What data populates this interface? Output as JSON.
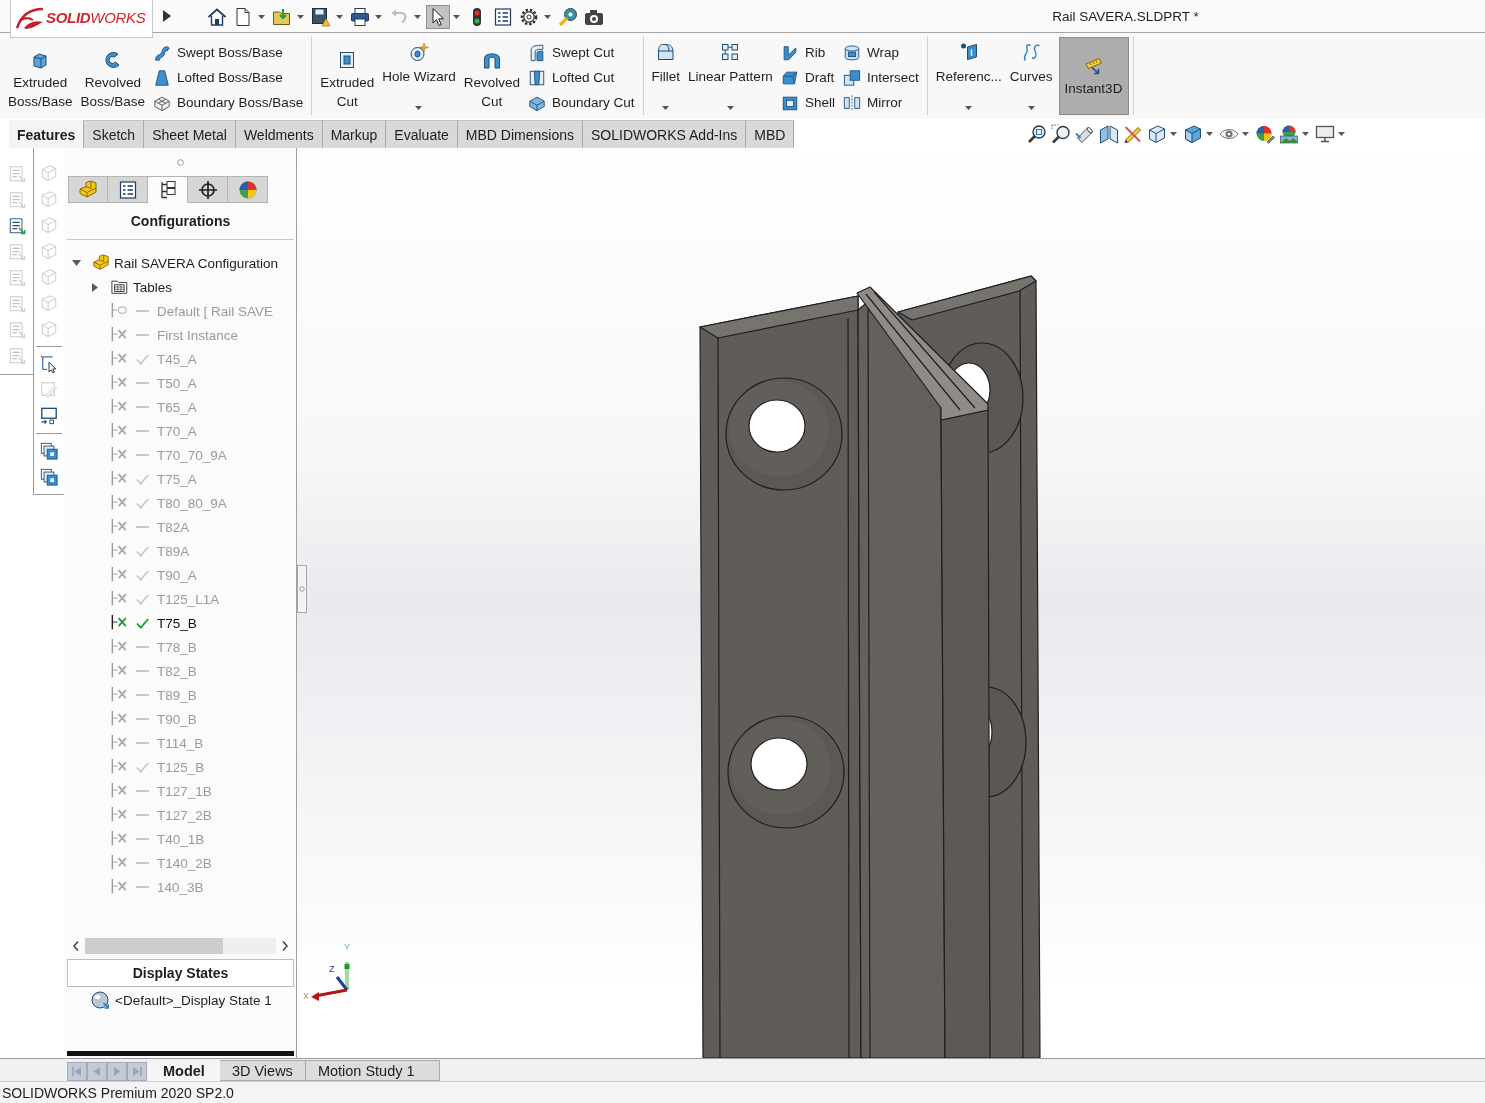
{
  "window": {
    "logo": "**SOLID**WORKS",
    "title": "Rail SAVERA.SLDPRT *"
  },
  "quick_access": [
    {
      "dropdown": false,
      "disabled": false,
      "pressed": false
    },
    {
      "dropdown": true,
      "disabled": false,
      "pressed": false
    },
    {
      "dropdown": true,
      "disabled": false,
      "pressed": false
    },
    {
      "dropdown": true,
      "disabled": false,
      "pressed": false
    },
    {
      "dropdown": true,
      "disabled": false,
      "pressed": false
    },
    {
      "dropdown": true,
      "disabled": true,
      "pressed": false
    },
    {
      "dropdown": true,
      "disabled": false,
      "pressed": true
    },
    {
      "dropdown": false,
      "disabled": false,
      "pressed": false
    },
    {
      "dropdown": false,
      "disabled": false,
      "pressed": false
    },
    {
      "dropdown": true,
      "disabled": false,
      "pressed": false
    },
    {
      "dropdown": false,
      "disabled": false,
      "pressed": false
    },
    {
      "dropdown": false,
      "disabled": false,
      "pressed": false
    }
  ],
  "ribbon": {
    "groups": [
      {
        "items": [
          {
            "kind": "large",
            "label": "Extruded Boss/Base"
          },
          {
            "kind": "large",
            "label": "Revolved Boss/Base"
          },
          {
            "kind": "column",
            "buttons": [
              "Swept Boss/Base",
              "Lofted Boss/Base",
              "Boundary Boss/Base"
            ]
          }
        ]
      },
      {
        "items": [
          {
            "kind": "large",
            "label": "Extruded Cut"
          },
          {
            "kind": "dropdown",
            "label": "Hole Wizard"
          },
          {
            "kind": "large",
            "label": "Revolved Cut"
          },
          {
            "kind": "column",
            "buttons": [
              "Swept Cut",
              "Lofted Cut",
              "Boundary Cut"
            ]
          }
        ]
      },
      {
        "items": [
          {
            "kind": "dropdown",
            "label": "Fillet"
          },
          {
            "kind": "dropdown",
            "label": "Linear Pattern"
          },
          {
            "kind": "column",
            "buttons": [
              "Rib",
              "Draft",
              "Shell"
            ]
          },
          {
            "kind": "column",
            "buttons": [
              "Wrap",
              "Intersect",
              "Mirror"
            ]
          }
        ]
      },
      {
        "items": [
          {
            "kind": "dropdown",
            "label": "Referenc..."
          },
          {
            "kind": "dropdown",
            "label": "Curves"
          },
          {
            "kind": "toggle",
            "label": "Instant3D",
            "on": true
          }
        ]
      }
    ]
  },
  "command_tabs": [
    {
      "label": "Features",
      "selected": true
    },
    {
      "label": "Sketch",
      "selected": false
    },
    {
      "label": "Sheet Metal",
      "selected": false
    },
    {
      "label": "Weldments",
      "selected": false
    },
    {
      "label": "Markup",
      "selected": false
    },
    {
      "label": "Evaluate",
      "selected": false
    },
    {
      "label": "MBD Dimensions",
      "selected": false
    },
    {
      "label": "SOLIDWORKS Add-Ins",
      "selected": false
    },
    {
      "label": "MBD",
      "selected": false
    }
  ],
  "view_toolbar": [
    {
      "dropdown": false
    },
    {
      "dropdown": false
    },
    {
      "dropdown": false
    },
    {
      "dropdown": false
    },
    {
      "dropdown": false
    },
    {
      "dropdown": true
    },
    {
      "dropdown": true
    },
    {
      "dropdown": true
    },
    {
      "dropdown": false
    },
    {
      "dropdown": true
    },
    {
      "dropdown": true
    }
  ],
  "side_toolbars": [
    {
      "groups": [
        [
          {
            "disabled": true
          },
          {
            "disabled": true
          },
          {
            "disabled": false
          },
          {
            "disabled": true
          },
          {
            "disabled": true
          },
          {
            "disabled": true
          },
          {
            "disabled": true
          },
          {
            "disabled": true
          }
        ]
      ]
    },
    {
      "groups": [
        [
          {
            "disabled": true
          },
          {
            "disabled": true
          },
          {
            "disabled": true
          },
          {
            "disabled": true
          },
          {
            "disabled": true
          },
          {
            "disabled": true
          },
          {
            "disabled": true
          }
        ],
        [
          {
            "disabled": false
          },
          {
            "disabled": true
          },
          {
            "disabled": false
          }
        ],
        [
          {
            "disabled": false
          },
          {
            "disabled": false
          }
        ]
      ]
    }
  ],
  "feature_panel": {
    "tabs": [
      {
        "selected": false
      },
      {
        "selected": false
      },
      {
        "selected": true
      },
      {
        "selected": false
      },
      {
        "selected": false
      }
    ],
    "title": "Configurations",
    "tree": {
      "label": "Rail SAVERA Configuration",
      "expanded": true,
      "children": [
        {
          "kind": "folder",
          "label": "Tables",
          "expanded": false
        },
        {
          "kind": "base",
          "label": "Default [ Rail SAVE",
          "checked": false,
          "active": false
        },
        {
          "kind": "configuration",
          "label": "First Instance",
          "checked": false,
          "active": false
        },
        {
          "kind": "configuration",
          "label": "T45_A",
          "checked": true,
          "active": false
        },
        {
          "kind": "configuration",
          "label": "T50_A",
          "checked": false,
          "active": false
        },
        {
          "kind": "configuration",
          "label": "T65_A",
          "checked": false,
          "active": false
        },
        {
          "kind": "configuration",
          "label": "T70_A",
          "checked": false,
          "active": false
        },
        {
          "kind": "configuration",
          "label": "T70_70_9A",
          "checked": false,
          "active": false
        },
        {
          "kind": "configuration",
          "label": "T75_A",
          "checked": true,
          "active": false
        },
        {
          "kind": "configuration",
          "label": "T80_80_9A",
          "checked": true,
          "active": false
        },
        {
          "kind": "configuration",
          "label": "T82A",
          "checked": false,
          "active": false
        },
        {
          "kind": "configuration",
          "label": "T89A",
          "checked": true,
          "active": false
        },
        {
          "kind": "configuration",
          "label": "T90_A",
          "checked": true,
          "active": false
        },
        {
          "kind": "configuration",
          "label": "T125_L1A",
          "checked": true,
          "active": false
        },
        {
          "kind": "configuration",
          "label": "T75_B",
          "checked": true,
          "active": true
        },
        {
          "kind": "configuration",
          "label": "T78_B",
          "checked": false,
          "active": false
        },
        {
          "kind": "configuration",
          "label": "T82_B",
          "checked": false,
          "active": false
        },
        {
          "kind": "configuration",
          "label": "T89_B",
          "checked": false,
          "active": false
        },
        {
          "kind": "configuration",
          "label": "T90_B",
          "checked": false,
          "active": false
        },
        {
          "kind": "configuration",
          "label": "T114_B",
          "checked": false,
          "active": false
        },
        {
          "kind": "configuration",
          "label": "T125_B",
          "checked": true,
          "active": false
        },
        {
          "kind": "configuration",
          "label": "T127_1B",
          "checked": false,
          "active": false
        },
        {
          "kind": "configuration",
          "label": "T127_2B",
          "checked": false,
          "active": false
        },
        {
          "kind": "configuration",
          "label": "T40_1B",
          "checked": false,
          "active": false
        },
        {
          "kind": "configuration",
          "label": "T140_2B",
          "checked": false,
          "active": false
        },
        {
          "kind": "configuration",
          "label": "140_3B",
          "checked": false,
          "active": false
        }
      ]
    },
    "display_states": {
      "title": "Display States",
      "items": [
        {
          "label": "<Default>_Display State 1"
        }
      ]
    }
  },
  "viewport": {
    "triad": {
      "x": "X",
      "y": "Y",
      "z": "Z"
    }
  },
  "bottom_tabs": {
    "nav_buttons": [
      {
        "disabled": true
      },
      {
        "disabled": true
      },
      {
        "disabled": true
      },
      {
        "disabled": true
      }
    ],
    "tabs": [
      {
        "label": "Model",
        "selected": true
      },
      {
        "label": "3D Views",
        "selected": false
      },
      {
        "label": "Motion Study 1",
        "selected": false
      }
    ]
  },
  "status_bar": {
    "text": "SOLIDWORKS Premium 2020 SP2.0"
  }
}
